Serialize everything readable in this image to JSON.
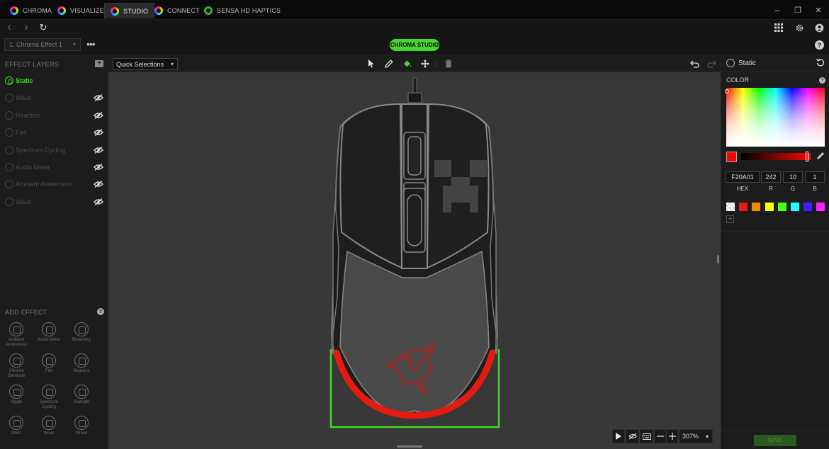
{
  "tabs": [
    {
      "label": "CHROMA",
      "active": false
    },
    {
      "label": "VISUALIZER",
      "active": false
    },
    {
      "label": "STUDIO",
      "active": true
    },
    {
      "label": "CONNECT",
      "active": false
    },
    {
      "label": "SENSA HD HAPTICS",
      "active": false
    }
  ],
  "window": {
    "minimize": "–",
    "restore": "❐",
    "close": "✕"
  },
  "nav": {
    "back": "‹",
    "forward": "›",
    "refresh": "↻"
  },
  "header": {
    "effect_select": "1. Chroma Effect 1",
    "more": "•••",
    "center_pill": "CHROMA STUDIO",
    "help": "?"
  },
  "left": {
    "layers_title": "EFFECT LAYERS",
    "add_layer": "+",
    "layers": [
      {
        "label": "Static",
        "active": true
      },
      {
        "label": "Wave",
        "active": false
      },
      {
        "label": "Reactive",
        "active": false
      },
      {
        "label": "Fire",
        "active": false
      },
      {
        "label": "Spectrum Cycling",
        "active": false
      },
      {
        "label": "Audio Meter",
        "active": false
      },
      {
        "label": "Ambient Awareness",
        "active": false
      },
      {
        "label": "Wave",
        "active": false
      }
    ],
    "add_effect_title": "ADD EFFECT",
    "add_effect_help": "?",
    "effects": [
      [
        "Ambient",
        "Awareness"
      ],
      [
        "Audio Meter"
      ],
      [
        "Breathing"
      ],
      [
        "Chroma",
        "Generate"
      ],
      [
        "Fire"
      ],
      [
        "Reactive"
      ],
      [
        "Ripple"
      ],
      [
        "Spectrum",
        "Cycling"
      ],
      [
        "Starlight"
      ],
      [
        "Static"
      ],
      [
        "Wave"
      ],
      [
        "Wheel"
      ]
    ]
  },
  "toolbar": {
    "quick_selections": "Quick Selections",
    "caret": "▾"
  },
  "canvas": {
    "zoom": "307%"
  },
  "right": {
    "effect_title": "Static",
    "color_label": "COLOR",
    "help": "?",
    "hex_value": "F20A01",
    "r_value": "242",
    "g_value": "10",
    "b_value": "1",
    "hex_label": "HEX",
    "r_label": "R",
    "g_label": "G",
    "b_label": "B",
    "current_color": "#f20a01",
    "presets": [
      "transparent",
      "#e41b12",
      "#f18a00",
      "#ffff00",
      "#44ff22",
      "#22ffff",
      "#4a1aff",
      "#ff22ff"
    ],
    "add_preset": "+",
    "save": "SAVE"
  },
  "colors": {
    "accent": "#44d62c",
    "red": "#e41b12"
  }
}
